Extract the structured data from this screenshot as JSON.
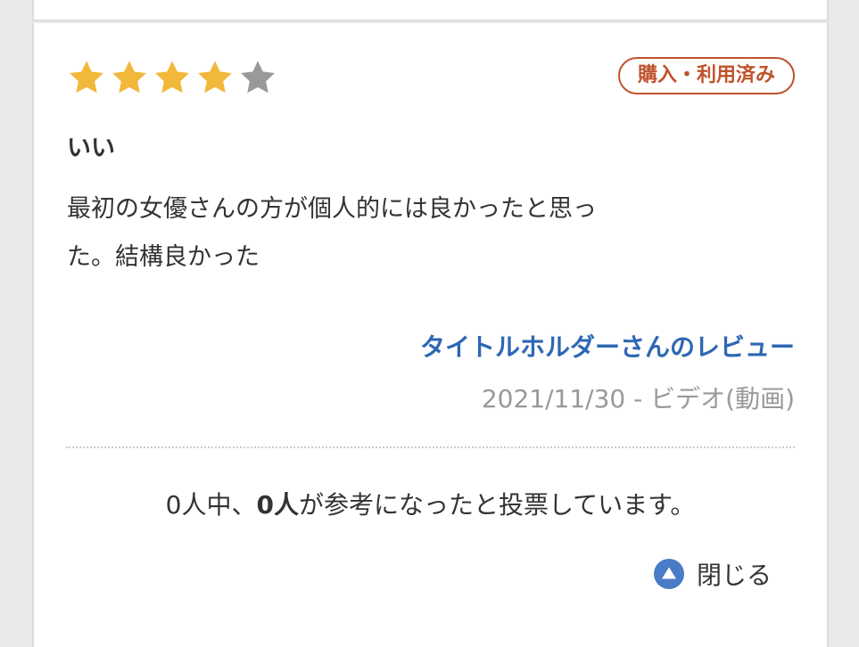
{
  "review": {
    "rating": 4,
    "max_rating": 5,
    "star_filled_color": "#f2b83c",
    "star_empty_color": "#999999",
    "badge": "購入・利用済み",
    "title": "いい",
    "body_line1": "最初の女優さんの方が個人的には良かったと思っ",
    "body_line2": "た。結構良かった",
    "reviewer": "タイトルホルダーさんのレビュー",
    "meta": "2021/11/30 - ビデオ(動画)"
  },
  "votes": {
    "prefix": "0人中、",
    "helpful_count": "0人",
    "suffix": "が参考になったと投票しています。"
  },
  "actions": {
    "close_label": "閉じる",
    "close_icon": "triangle-up-circle-icon"
  },
  "colors": {
    "badge": "#c0532c",
    "link": "#2e67b3",
    "icon": "#4a7bc6"
  }
}
